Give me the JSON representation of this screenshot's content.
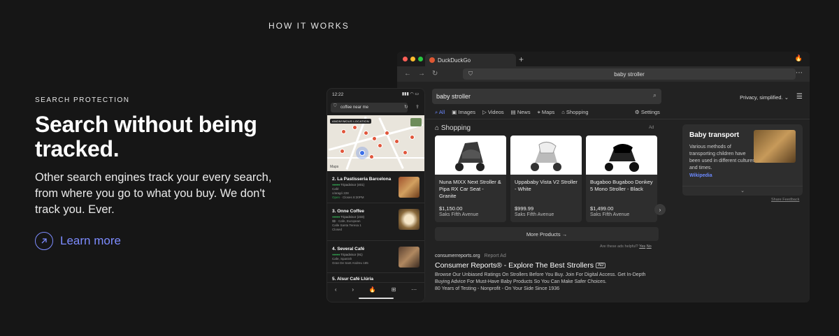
{
  "eyebrow": "HOW IT WORKS",
  "hero": {
    "kicker": "SEARCH PROTECTION",
    "title": "Search without being tracked.",
    "body": "Other search engines track your every search, from where you go to what you buy. We don't track you. Ever.",
    "cta": "Learn more"
  },
  "browser": {
    "tab_title": "DuckDuckGo",
    "url": "baby stroller",
    "search_query": "baby stroller",
    "privacy_label": "Privacy, simplified. ⌄",
    "tabs": [
      "All",
      "Images",
      "Videos",
      "News",
      "Maps",
      "Shopping"
    ],
    "settings": "Settings",
    "shopping_title": "Shopping",
    "ad_label": "Ad",
    "products": [
      {
        "name": "Nuna MIXX Next Stroller & Pipa RX Car Seat - Granite",
        "price": "$1,150.00",
        "store": "Saks Fifth Avenue"
      },
      {
        "name": "Uppababy Vista V2 Stroller - White",
        "price": "$999.99",
        "store": "Saks Fifth Avenue"
      },
      {
        "name": "Bugaboo Bugaboo Donkey 5 Mono Stroller - Black",
        "price": "$1,499.00",
        "store": "Saks Fifth Avenue"
      }
    ],
    "more_products": "More Products →",
    "ad_help": "Are these ads helpful?",
    "ad_yes": "Yes",
    "ad_no": "No",
    "result": {
      "source": "consumerreports.org",
      "report": "Report Ad",
      "title": "Consumer Reports® - Explore The Best Strollers",
      "badge": "AD",
      "desc1": "Browse Our Unbiased Ratings On Strollers Before You Buy. Join For Digital Access. Get In-Depth",
      "desc2": "Buying Advice For Must-Have Baby Products So You Can Make Safer Choices.",
      "desc3": "80 Years of Testing - Nonprofit - On Your Side Since 1936"
    },
    "panel": {
      "title": "Baby transport",
      "desc": "Various methods of transporting children have been used in different cultures and times.",
      "link": "Wikipedia",
      "foot": "⌄"
    },
    "feedback": "Share Feedback"
  },
  "phone": {
    "time": "12:22",
    "signal": "▮▮▮ ◠ ▭",
    "query": "coffee near me",
    "map_tag": "ANONYMOUS LOCATION",
    "maps_label": "Maps",
    "listings": [
      {
        "name": "2. La Pastisseria Barcelona",
        "reviews": "Tripadvisor (401)",
        "l1": "Café",
        "l2": "c/aragó 228",
        "l3open": "Open",
        "l3": " · Closes 8:30PM"
      },
      {
        "name": "3. Onne Coffee",
        "reviews": "Tripadvisor (233)",
        "l1": "$$ · Cafe, European",
        "l2": "Calle Santa Teresa 1",
        "l3open": "",
        "l3": "Closed"
      },
      {
        "name": "4. Several Café",
        "reviews": "Tripadvisor (91)",
        "l1": "Cafe, Spanish",
        "l2": "Gran De Sant Andreu 185",
        "l3open": "",
        "l3": ""
      },
      {
        "name": "5. Alsur Café Llúria",
        "reviews": "",
        "l1": "",
        "l2": "",
        "l3open": "",
        "l3": ""
      }
    ]
  },
  "colors": {
    "accent": "#7d8cff",
    "link": "#6b89ff",
    "background": "#161616"
  }
}
